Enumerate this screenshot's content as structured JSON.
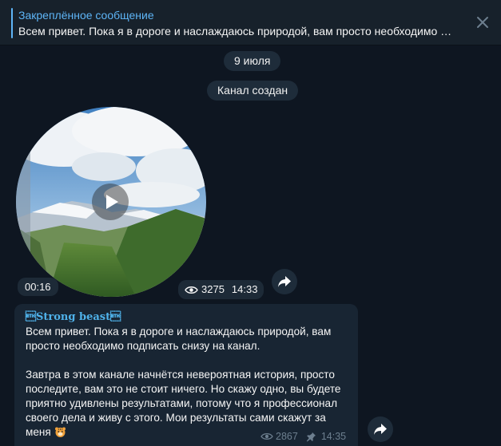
{
  "pinned": {
    "title": "Закреплённое сообщение",
    "text": "Всем привет. Пока я в дороге и наслаждаюсь природой, вам просто необходимо под..."
  },
  "service": {
    "date": "9 июля",
    "channel_created": "Канал создан"
  },
  "video_message": {
    "duration": "00:16",
    "views": "3275",
    "time": "14:33"
  },
  "text_message": {
    "author": "\u0003Strong beast\u0003",
    "paragraph1": "Всем привет. Пока я в дороге и наслаждаюсь природой, вам просто необходимо подписать снизу на канал.",
    "paragraph2": "Завтра в этом канале начнётся невероятная история, просто последите, вам это не стоит ничего. Но скажу одно, вы будете приятно удивлены результатами, потому что я профессионал своего дела и живу с этого. Мои результаты сами скажут за меня",
    "views": "2867",
    "time": "14:35"
  },
  "icons": {
    "close": "close-icon",
    "play": "play-icon",
    "views": "eye-icon",
    "pinned": "pin-icon",
    "share": "share-arrow-icon",
    "emoji": "tiger-emoji"
  },
  "colors": {
    "background": "#0e1621",
    "panel": "#17212b",
    "bubble": "#182533",
    "accent": "#5eb5f7",
    "meta": "#6d7f8f"
  }
}
